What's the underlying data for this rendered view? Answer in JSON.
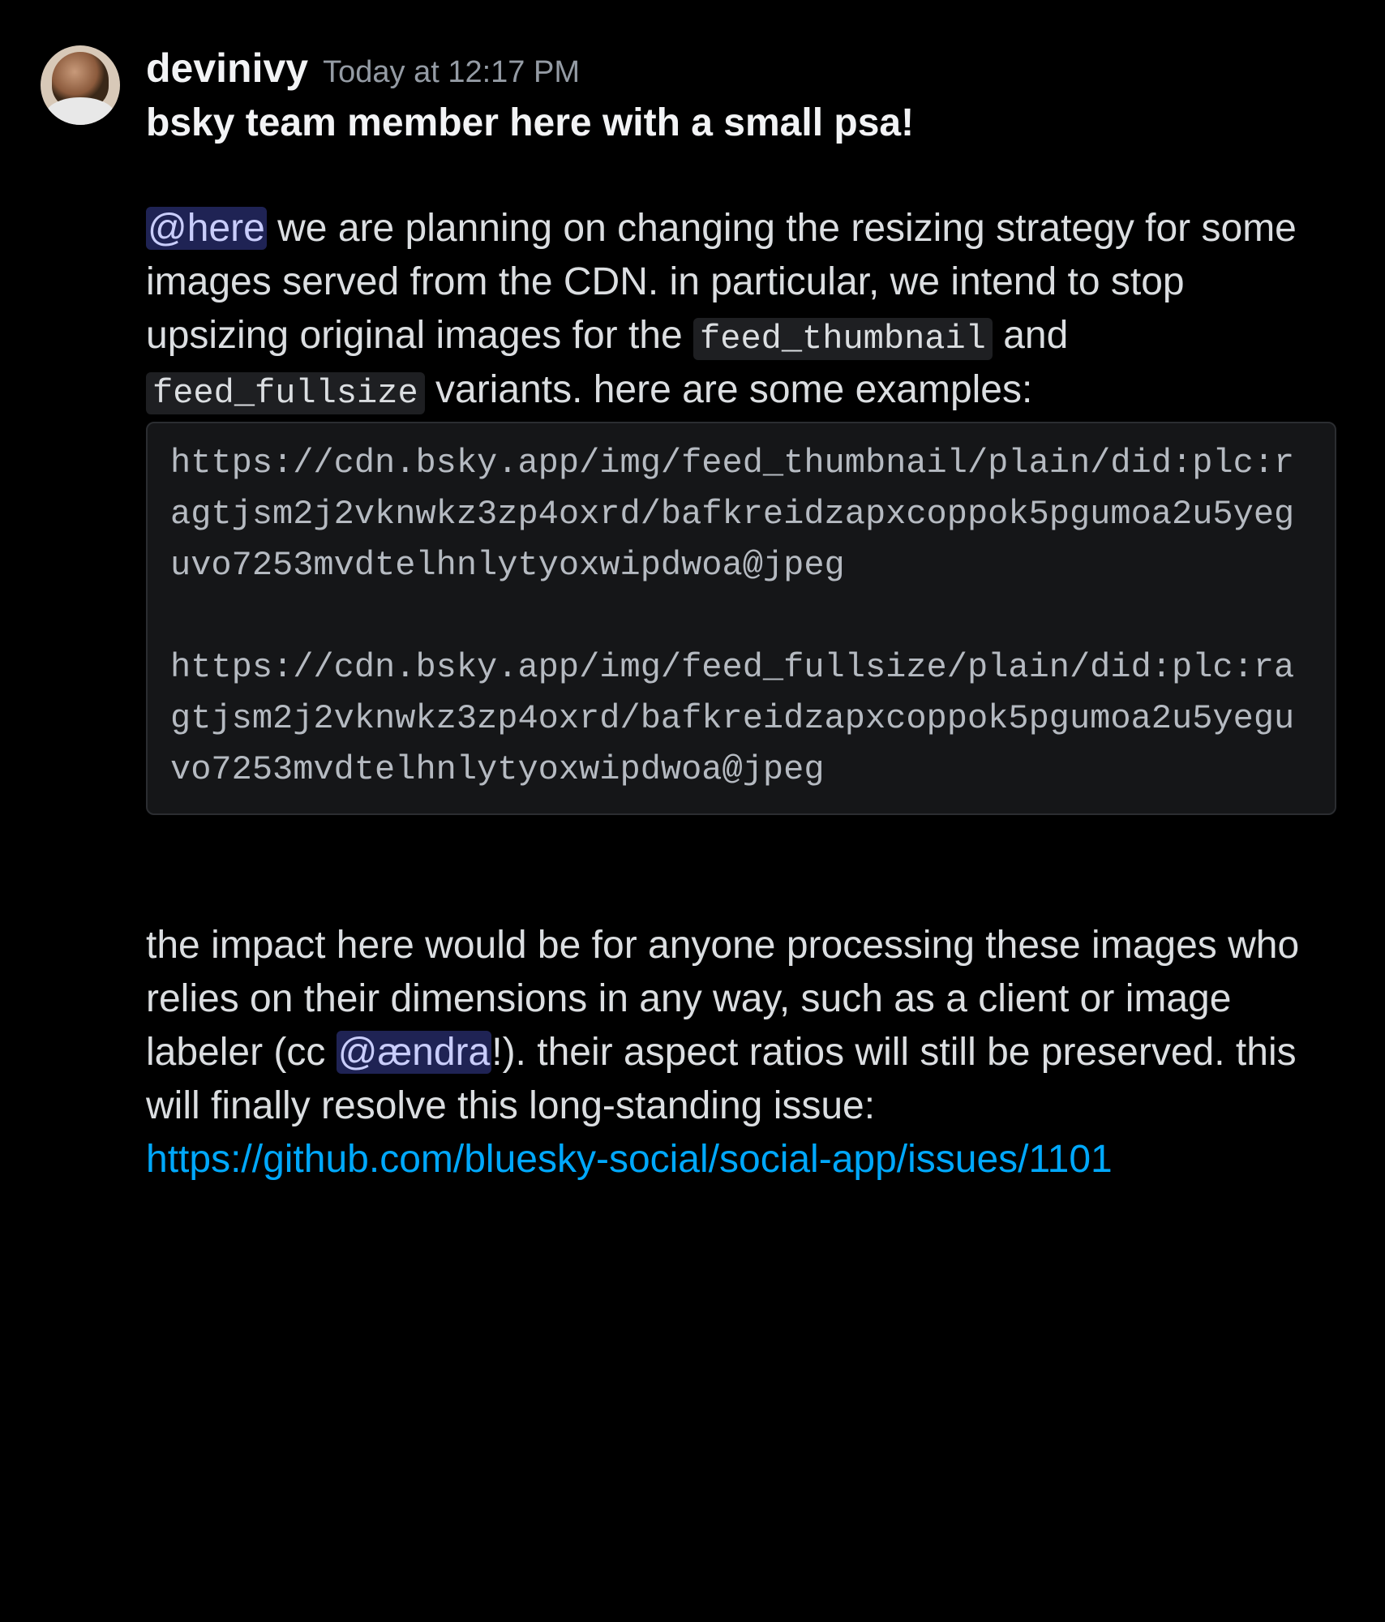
{
  "message": {
    "author": "devinivy",
    "timestamp": "Today at 12:17 PM",
    "line_bold": "bsky team member here with a small psa!",
    "p1_mention": "@here",
    "p1_a": " we are planning on changing the resizing strategy for some images served from the CDN.  in particular, we intend to stop upsizing original images for the ",
    "p1_code1": "feed_thumbnail",
    "p1_mid": " and ",
    "p1_code2": "feed_fullsize",
    "p1_b": "  variants.  here are some examples:",
    "codeblock": "https://cdn.bsky.app/img/feed_thumbnail/plain/did:plc:ragtjsm2j2vknwkz3zp4oxrd/bafkreidzapxcoppok5pgumoa2u5yeguvo7253mvdtelhnlytyoxwipdwoa@jpeg\n\nhttps://cdn.bsky.app/img/feed_fullsize/plain/did:plc:ragtjsm2j2vknwkz3zp4oxrd/bafkreidzapxcoppok5pgumoa2u5yeguvo7253mvdtelhnlytyoxwipdwoa@jpeg",
    "p2_a": "the impact here would be for anyone processing these images who relies on their dimensions in any way, such as a client or image labeler (cc ",
    "p2_mention": "@ændra",
    "p2_b": "!).  their aspect ratios will still be preserved.  this will finally resolve this long-standing issue:",
    "link": "https://github.com/bluesky-social/social-app/issues/1101"
  }
}
